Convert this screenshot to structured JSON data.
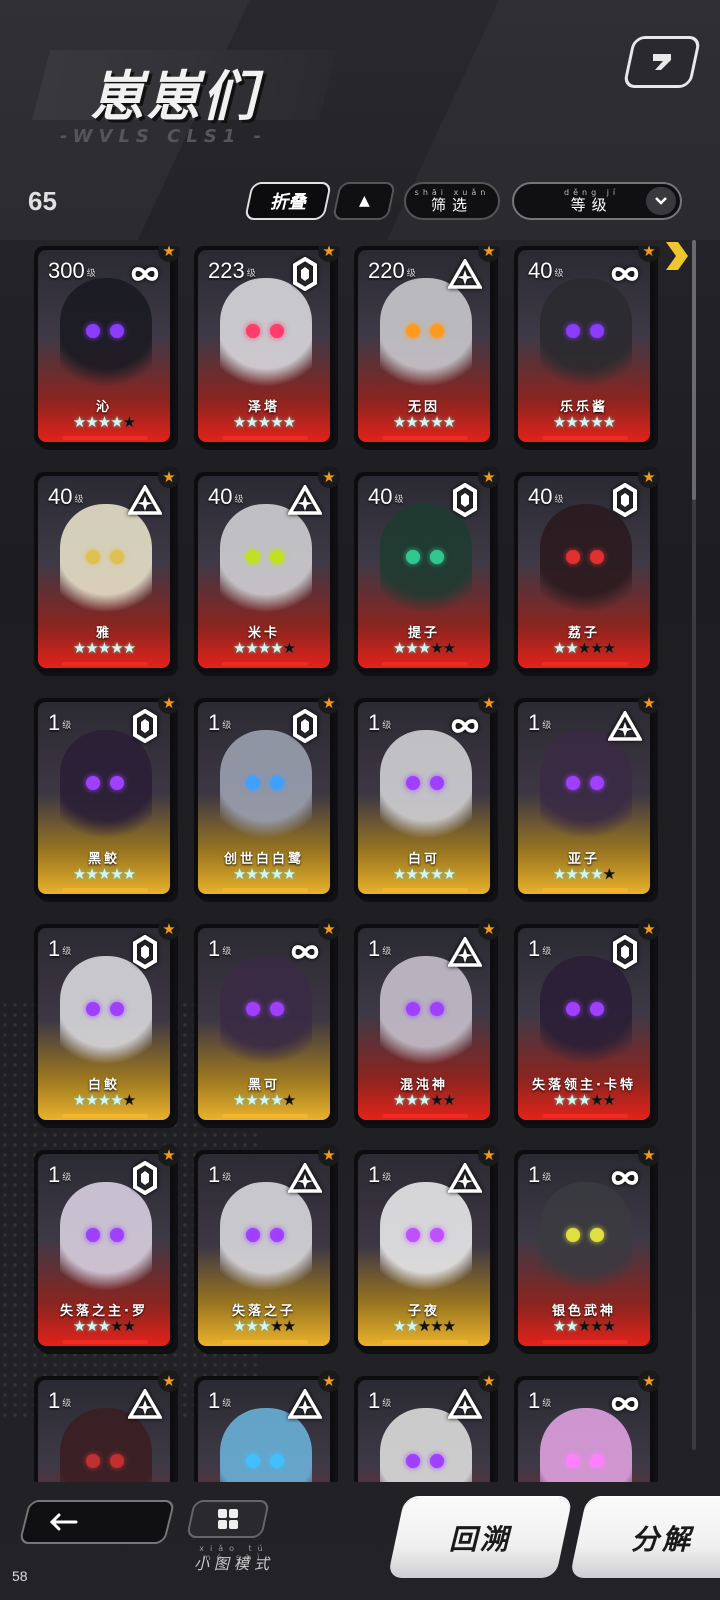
{
  "header": {
    "title": "崽崽们",
    "subtitle": "-WVLS CLS1 -"
  },
  "toolbar": {
    "count": "65",
    "fold_label": "折叠",
    "filter_pinyin": "shāi xuǎn",
    "filter_label": "筛选",
    "level_pinyin": "děng jí",
    "level_label": "等级"
  },
  "level_suffix": "级",
  "characters": [
    {
      "name": "沁",
      "level": "300",
      "rarity": "red",
      "class": "infinity-icon",
      "stars": 4
    },
    {
      "name": "泽塔",
      "level": "223",
      "rarity": "red",
      "class": "hexagon-icon",
      "stars": 5
    },
    {
      "name": "无因",
      "level": "220",
      "rarity": "red",
      "class": "triangle-icon",
      "stars": 5
    },
    {
      "name": "乐乐酱",
      "level": "40",
      "rarity": "red",
      "class": "infinity-icon",
      "stars": 5
    },
    {
      "name": "雅",
      "level": "40",
      "rarity": "red",
      "class": "triangle-icon",
      "stars": 5
    },
    {
      "name": "米卡",
      "level": "40",
      "rarity": "red",
      "class": "triangle-icon",
      "stars": 4
    },
    {
      "name": "提子",
      "level": "40",
      "rarity": "red",
      "class": "hexagon-icon",
      "stars": 3
    },
    {
      "name": "荔子",
      "level": "40",
      "rarity": "red",
      "class": "hexagon-icon",
      "stars": 2
    },
    {
      "name": "黑鲛",
      "level": "1",
      "rarity": "gold",
      "class": "hexagon-icon",
      "stars": 5
    },
    {
      "name": "创世白白鹭",
      "level": "1",
      "rarity": "gold",
      "class": "hexagon-icon",
      "stars": 5
    },
    {
      "name": "白可",
      "level": "1",
      "rarity": "gold",
      "class": "infinity-icon",
      "stars": 5
    },
    {
      "name": "亚子",
      "level": "1",
      "rarity": "gold",
      "class": "triangle-icon",
      "stars": 4
    },
    {
      "name": "白鲛",
      "level": "1",
      "rarity": "gold",
      "class": "hexagon-icon",
      "stars": 4
    },
    {
      "name": "黑可",
      "level": "1",
      "rarity": "gold",
      "class": "infinity-icon",
      "stars": 4
    },
    {
      "name": "混沌神",
      "level": "1",
      "rarity": "red",
      "class": "triangle-icon",
      "stars": 3
    },
    {
      "name": "失落领主·卡特",
      "level": "1",
      "rarity": "red",
      "class": "hexagon-icon",
      "stars": 3
    },
    {
      "name": "失落之主·罗",
      "level": "1",
      "rarity": "red",
      "class": "hexagon-icon",
      "stars": 3
    },
    {
      "name": "失落之子",
      "level": "1",
      "rarity": "gold",
      "class": "triangle-icon",
      "stars": 3
    },
    {
      "name": "子夜",
      "level": "1",
      "rarity": "gold",
      "class": "triangle-icon",
      "stars": 2
    },
    {
      "name": "银色武神",
      "level": "1",
      "rarity": "red",
      "class": "infinity-icon",
      "stars": 2
    },
    {
      "name": "",
      "level": "1",
      "rarity": "red",
      "class": "triangle-icon",
      "stars": 0
    },
    {
      "name": "",
      "level": "1",
      "rarity": "red",
      "class": "triangle-icon",
      "stars": 0
    },
    {
      "name": "",
      "level": "1",
      "rarity": "red",
      "class": "triangle-icon",
      "stars": 0
    },
    {
      "name": "",
      "level": "1",
      "rarity": "red",
      "class": "infinity-icon",
      "stars": 0
    }
  ],
  "bottom": {
    "mini_pinyin": "xiǎo tú mó shì",
    "mini_label": "小图模式",
    "trace_label": "回溯",
    "decompose_label": "分解",
    "corner_number": "58"
  },
  "colors": {
    "red_rarity": "#e3221a",
    "gold_rarity": "#eab22c",
    "star_badge": "#f39a1c"
  }
}
